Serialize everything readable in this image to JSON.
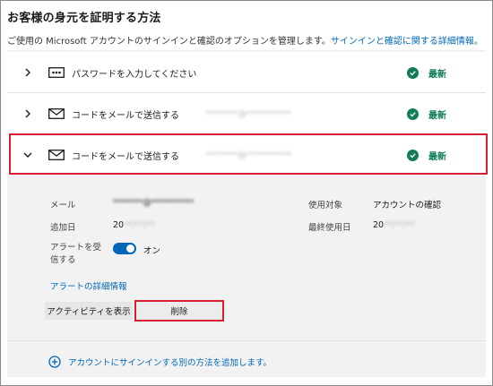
{
  "header": {
    "title": "お客様の身元を証明する方法",
    "description_text": "ご使用の Microsoft アカウントのサインインと確認のオプションを管理します。",
    "description_link": "サインインと確認に関する詳細情報。"
  },
  "methods": [
    {
      "icon": "password-dots-icon",
      "label": "パスワードを入力してください",
      "email": "",
      "status": "最新",
      "expanded": false
    },
    {
      "icon": "mail-icon",
      "label": "コードをメールで送信する",
      "email": "*******@**********",
      "status": "最新",
      "expanded": false
    },
    {
      "icon": "mail-icon",
      "label": "コードをメールで送信する",
      "email": "*******@**********",
      "status": "最新",
      "expanded": true
    }
  ],
  "details": {
    "email_label": "メール",
    "email_value": "*******@**********",
    "added_label": "追加日",
    "added_value": "20",
    "added_value_blur": "**/**/**",
    "usage_label": "使用対象",
    "usage_value": "アカウントの確認",
    "last_used_label": "最終使用日",
    "last_used_value": "20",
    "last_used_value_blur": "**/**/**",
    "alert_label": "アラートを受\n信する",
    "alert_state": "オン",
    "alert_link": "アラートの詳細情報",
    "activity_button": "アクティビティを表示",
    "delete_button": "削除"
  },
  "footer": {
    "add_method": "アカウントにサインインする別の方法を追加します。"
  },
  "colors": {
    "accent": "#0067b8",
    "status": "#107c5a",
    "highlight": "#d6202f"
  }
}
